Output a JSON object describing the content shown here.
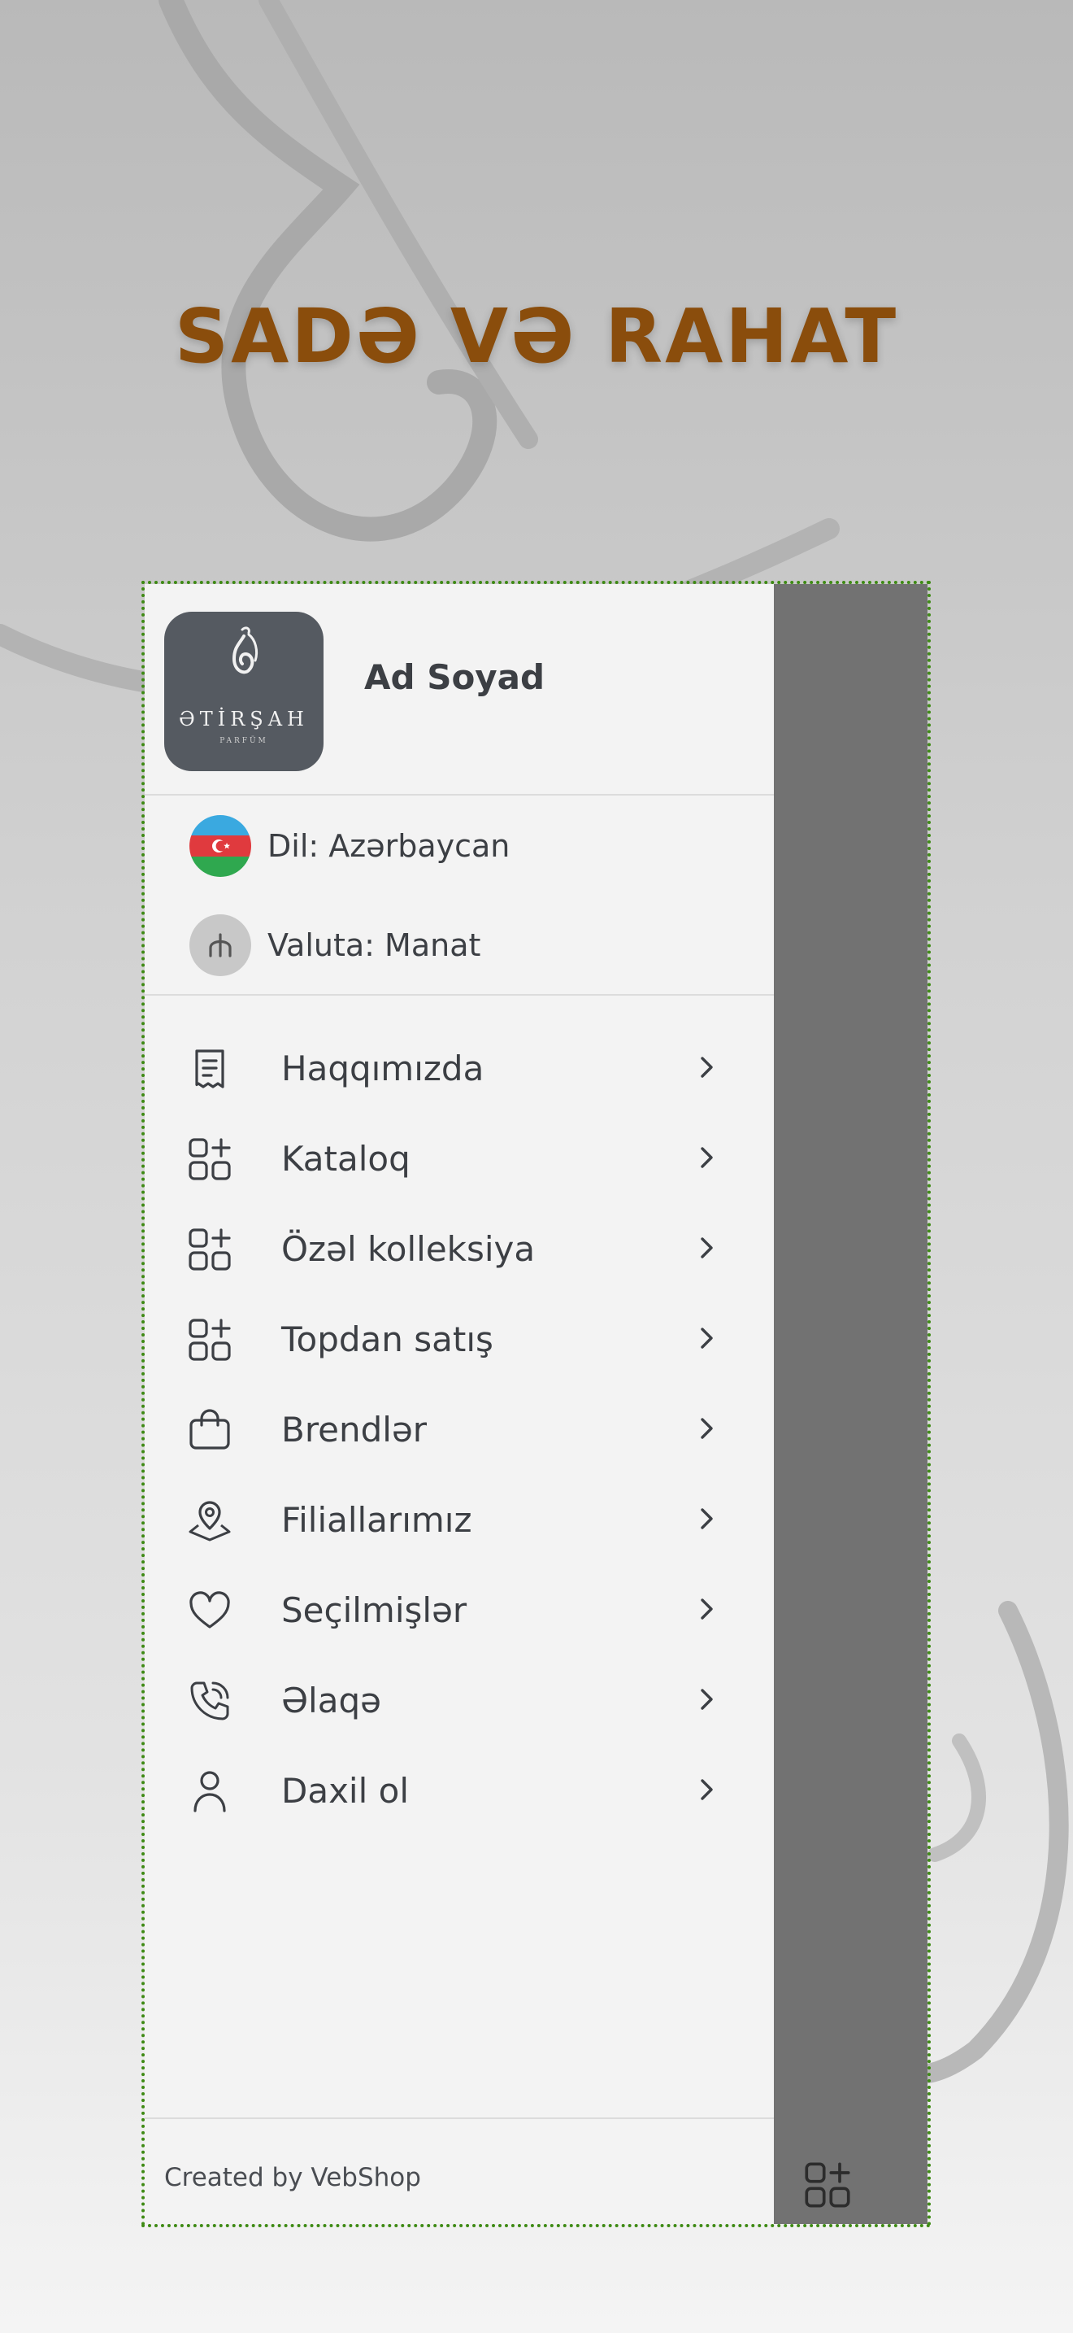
{
  "page": {
    "headline": "SADƏ VƏ RAHAT"
  },
  "colors": {
    "headline": "#8a4d0c",
    "drawer_bg": "#f3f3f3",
    "overlay_bg": "#727272",
    "text": "#3c3f44",
    "logo_bg": "#555a61",
    "frame_outline": "#3e8a14"
  },
  "drawer": {
    "logo": {
      "brand": "ƏTİRŞAH",
      "sub": "PARFÜM",
      "icon": "perfume-bottle-logo"
    },
    "user_name": "Ad Soyad",
    "language": {
      "label": "Dil: Azərbaycan",
      "icon": "azerbaijan-flag-icon"
    },
    "currency": {
      "label": "Valuta: Manat",
      "icon": "manat-icon"
    },
    "menu": [
      {
        "label": "Haqqımızda",
        "icon": "receipt-icon"
      },
      {
        "label": "Kataloq",
        "icon": "category-icon"
      },
      {
        "label": "Özəl kolleksiya",
        "icon": "category-icon"
      },
      {
        "label": "Topdan satış",
        "icon": "category-icon"
      },
      {
        "label": "Brendlər",
        "icon": "bag-icon"
      },
      {
        "label": "Filiallarımız",
        "icon": "location-icon"
      },
      {
        "label": "Seçilmişlər",
        "icon": "heart-icon"
      },
      {
        "label": "Əlaqə",
        "icon": "phone-icon"
      },
      {
        "label": "Daxil ol",
        "icon": "user-icon"
      }
    ],
    "footer": "Created by VebShop"
  }
}
